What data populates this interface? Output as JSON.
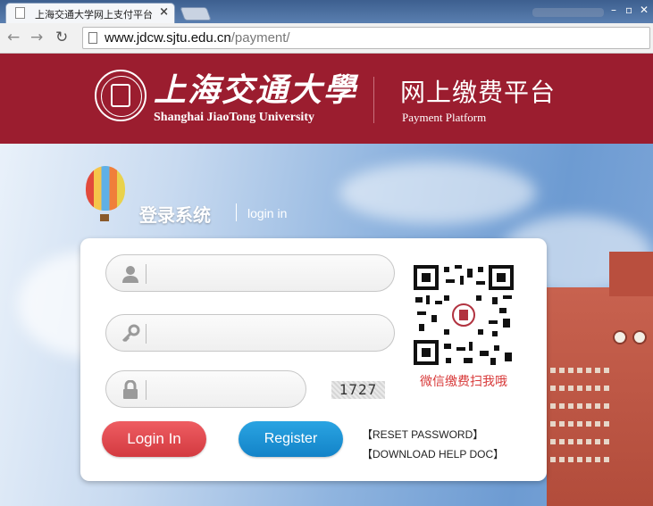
{
  "browser": {
    "tab_title": "上海交通大学网上支付平台",
    "tab_close": "×",
    "url_host": "www.jdcw.sjtu.edu.cn",
    "url_path": "/payment/",
    "icons": [
      "back-icon",
      "forward-icon",
      "reload-icon",
      "page-icon"
    ]
  },
  "header": {
    "university_cn": "上海交通大學",
    "university_en": "Shanghai JiaoTong University",
    "platform_cn": "网上缴费平台",
    "platform_en": "Payment Platform",
    "brand_color": "#9b1d2f"
  },
  "login": {
    "heading_cn": "登录系统",
    "heading_en": "login in",
    "fields": [
      {
        "icon": "user-icon",
        "value": "",
        "placeholder": ""
      },
      {
        "icon": "key-icon",
        "value": "",
        "placeholder": ""
      },
      {
        "icon": "lock-icon",
        "value": "",
        "placeholder": ""
      }
    ],
    "captcha_text": "1727",
    "qr_caption": "微信缴费扫我哦",
    "login_button": "Login In",
    "register_button": "Register",
    "reset_password": "【RESET PASSWORD】",
    "download_help": "【DOWNLOAD HELP DOC】",
    "colors": {
      "login": "#dd474c",
      "register": "#1b8fd4",
      "qr_caption": "#d83a3a"
    }
  }
}
